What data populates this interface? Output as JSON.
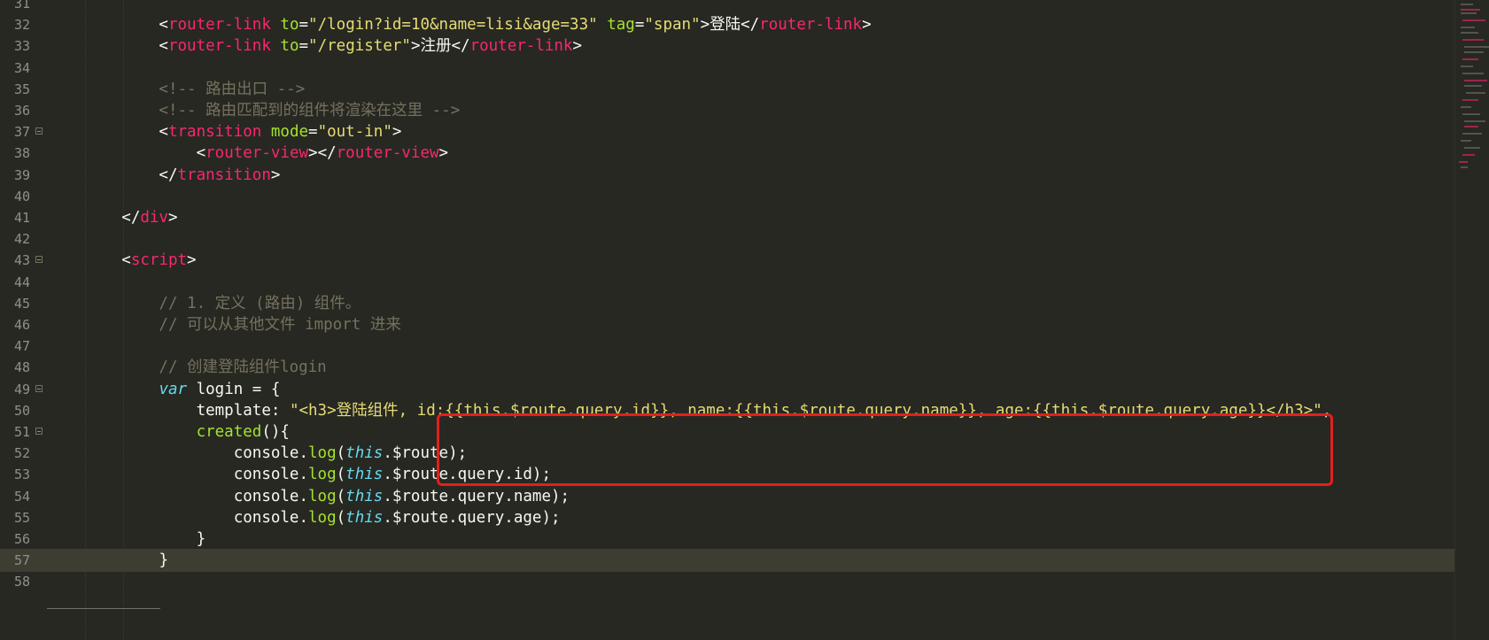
{
  "colors": {
    "background": "#272822",
    "tag": "#f92672",
    "attribute": "#a6e22e",
    "string": "#e6db74",
    "comment": "#75715e",
    "keyword": "#66d9ef",
    "highlight_box": "#e3201b"
  },
  "lines": [
    {
      "n": "31",
      "tokens": []
    },
    {
      "n": "32",
      "tokens": [
        {
          "c": "p",
          "t": "            <"
        },
        {
          "c": "tag",
          "t": "router-link"
        },
        {
          "c": "p",
          "t": " "
        },
        {
          "c": "attr",
          "t": "to"
        },
        {
          "c": "p",
          "t": "="
        },
        {
          "c": "str",
          "t": "\"/login?id=10&name=lisi&age=33\""
        },
        {
          "c": "p",
          "t": " "
        },
        {
          "c": "attr",
          "t": "tag"
        },
        {
          "c": "p",
          "t": "="
        },
        {
          "c": "str",
          "t": "\"span\""
        },
        {
          "c": "p",
          "t": ">登陆</"
        },
        {
          "c": "tag",
          "t": "router-link"
        },
        {
          "c": "p",
          "t": ">"
        }
      ]
    },
    {
      "n": "33",
      "tokens": [
        {
          "c": "p",
          "t": "            <"
        },
        {
          "c": "tag",
          "t": "router-link"
        },
        {
          "c": "p",
          "t": " "
        },
        {
          "c": "attr",
          "t": "to"
        },
        {
          "c": "p",
          "t": "="
        },
        {
          "c": "str",
          "t": "\"/register\""
        },
        {
          "c": "p",
          "t": ">注册</"
        },
        {
          "c": "tag",
          "t": "router-link"
        },
        {
          "c": "p",
          "t": ">"
        }
      ]
    },
    {
      "n": "34",
      "tokens": []
    },
    {
      "n": "35",
      "tokens": [
        {
          "c": "com",
          "t": "            <!-- 路由出口 -->"
        }
      ]
    },
    {
      "n": "36",
      "tokens": [
        {
          "c": "com",
          "t": "            <!-- 路由匹配到的组件将渲染在这里 -->"
        }
      ]
    },
    {
      "n": "37",
      "fold": true,
      "tokens": [
        {
          "c": "p",
          "t": "            <"
        },
        {
          "c": "tag",
          "t": "transition"
        },
        {
          "c": "p",
          "t": " "
        },
        {
          "c": "attr",
          "t": "mode"
        },
        {
          "c": "p",
          "t": "="
        },
        {
          "c": "str",
          "t": "\"out-in\""
        },
        {
          "c": "p",
          "t": ">"
        }
      ]
    },
    {
      "n": "38",
      "tokens": [
        {
          "c": "p",
          "t": "                <"
        },
        {
          "c": "tag",
          "t": "router-view"
        },
        {
          "c": "p",
          "t": "></"
        },
        {
          "c": "tag",
          "t": "router-view"
        },
        {
          "c": "p",
          "t": ">"
        }
      ]
    },
    {
      "n": "39",
      "tokens": [
        {
          "c": "p",
          "t": "            </"
        },
        {
          "c": "tag",
          "t": "transition"
        },
        {
          "c": "p",
          "t": ">"
        }
      ]
    },
    {
      "n": "40",
      "tokens": []
    },
    {
      "n": "41",
      "tokens": [
        {
          "c": "p",
          "t": "        </"
        },
        {
          "c": "tag",
          "t": "div"
        },
        {
          "c": "p",
          "t": ">"
        }
      ]
    },
    {
      "n": "42",
      "tokens": []
    },
    {
      "n": "43",
      "fold": true,
      "tokens": [
        {
          "c": "p",
          "t": "        <"
        },
        {
          "c": "tag",
          "t": "script"
        },
        {
          "c": "p",
          "t": ">"
        }
      ]
    },
    {
      "n": "44",
      "tokens": []
    },
    {
      "n": "45",
      "tokens": [
        {
          "c": "com",
          "t": "            // 1. 定义 (路由) 组件。"
        }
      ]
    },
    {
      "n": "46",
      "tokens": [
        {
          "c": "com",
          "t": "            // 可以从其他文件 import 进来"
        }
      ]
    },
    {
      "n": "47",
      "tokens": []
    },
    {
      "n": "48",
      "tokens": [
        {
          "c": "com",
          "t": "            // 创建登陆组件login"
        }
      ]
    },
    {
      "n": "49",
      "fold": true,
      "tokens": [
        {
          "c": "p",
          "t": "            "
        },
        {
          "c": "kw",
          "t": "var"
        },
        {
          "c": "p",
          "t": " login = {"
        }
      ]
    },
    {
      "n": "50",
      "tokens": [
        {
          "c": "p",
          "t": "                template: "
        },
        {
          "c": "str",
          "t": "\"<h3>登陆组件, id:{{this.$route.query.id}}, name:{{this.$route.query.name}}, age:{{this.$route.query.age}}</h3>\""
        },
        {
          "c": "p",
          "t": ","
        }
      ]
    },
    {
      "n": "51",
      "fold": true,
      "tokens": [
        {
          "c": "p",
          "t": "                "
        },
        {
          "c": "fn",
          "t": "created"
        },
        {
          "c": "p",
          "t": "(){"
        }
      ]
    },
    {
      "n": "52",
      "tokens": [
        {
          "c": "p",
          "t": "                    console."
        },
        {
          "c": "fn",
          "t": "log"
        },
        {
          "c": "p",
          "t": "("
        },
        {
          "c": "kw",
          "t": "this"
        },
        {
          "c": "p",
          "t": ".$route);"
        }
      ]
    },
    {
      "n": "53",
      "tokens": [
        {
          "c": "p",
          "t": "                    console."
        },
        {
          "c": "fn",
          "t": "log"
        },
        {
          "c": "p",
          "t": "("
        },
        {
          "c": "kw",
          "t": "this"
        },
        {
          "c": "p",
          "t": ".$route.query.id);"
        }
      ]
    },
    {
      "n": "54",
      "tokens": [
        {
          "c": "p",
          "t": "                    console."
        },
        {
          "c": "fn",
          "t": "log"
        },
        {
          "c": "p",
          "t": "("
        },
        {
          "c": "kw",
          "t": "this"
        },
        {
          "c": "p",
          "t": ".$route.query.name);"
        }
      ]
    },
    {
      "n": "55",
      "tokens": [
        {
          "c": "p",
          "t": "                    console."
        },
        {
          "c": "fn",
          "t": "log"
        },
        {
          "c": "p",
          "t": "("
        },
        {
          "c": "kw",
          "t": "this"
        },
        {
          "c": "p",
          "t": ".$route.query.age);"
        }
      ]
    },
    {
      "n": "56",
      "tokens": [
        {
          "c": "p",
          "t": "                }"
        }
      ]
    },
    {
      "n": "57",
      "current": true,
      "tokens": [
        {
          "c": "p",
          "t": "            "
        },
        {
          "c": "p",
          "t": "}"
        }
      ]
    },
    {
      "n": "58",
      "tokens": []
    }
  ]
}
